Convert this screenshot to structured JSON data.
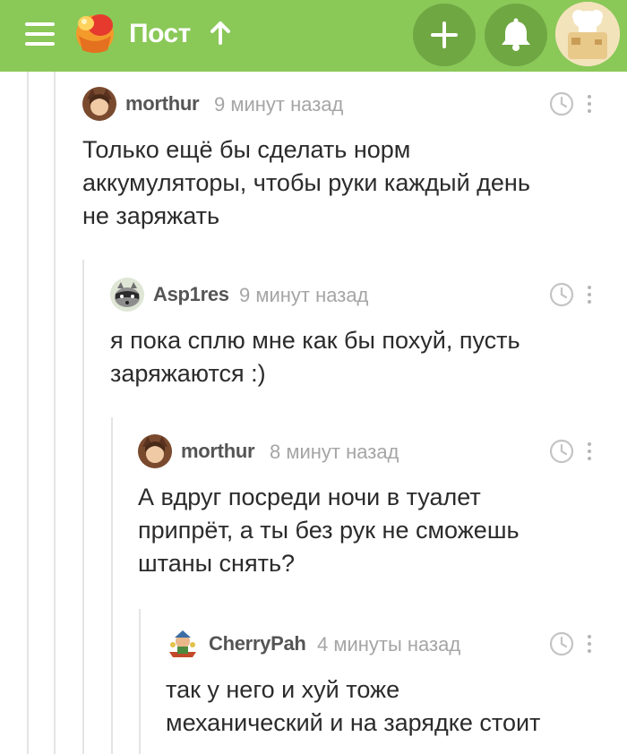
{
  "header": {
    "title": "Пост",
    "colors": {
      "brand_green": "#8ac858",
      "button_green": "#6fa743"
    },
    "icons": [
      "hamburger-icon",
      "logo-icon",
      "arrow-up-icon",
      "plus-icon",
      "bell-icon",
      "avatar"
    ]
  },
  "comments": [
    {
      "user": "morthur",
      "time": "9 минут назад",
      "text": "Только ещё бы сделать норм\nаккумуляторы, чтобы руки каждый день\nне заряжать"
    },
    {
      "user": "Asp1res",
      "time": "9 минут назад",
      "text": "я пока сплю мне как бы похуй, пусть\nзаряжаются :)"
    },
    {
      "user": "morthur",
      "time": "8 минут назад",
      "text": "А вдруг посреди ночи в туалет\nприпрёт, а ты без рук не сможешь\nштаны снять?"
    },
    {
      "user": "CherryPah",
      "time": "4 минуты назад",
      "text": "так у него и хуй тоже\nмеханический и на зарядке стоит"
    }
  ]
}
